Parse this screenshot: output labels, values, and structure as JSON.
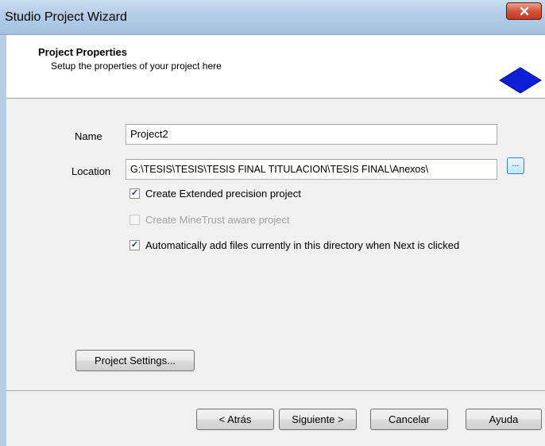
{
  "window": {
    "title": "Studio Project Wizard",
    "close_label": "x"
  },
  "header": {
    "title": "Project Properties",
    "subtitle": "Setup the properties of your project here",
    "icon": "blue-diamond-icon"
  },
  "form": {
    "name_label": "Name",
    "name_value": "Project2",
    "location_label": "Location",
    "location_value": "G:\\TESIS\\TESIS\\TESIS FINAL TITULACION\\TESIS FINAL\\Anexos\\",
    "browse_label": "...",
    "options": [
      {
        "label": "Create Extended precision project",
        "checked": true,
        "enabled": true
      },
      {
        "label": "Create MineTrust aware project",
        "checked": false,
        "enabled": false
      },
      {
        "label": "Automatically add files currently in this directory when Next is clicked",
        "checked": true,
        "enabled": true
      }
    ],
    "settings_button": "Project Settings..."
  },
  "footer": {
    "back": "< Atrás",
    "next": "Siguiente >",
    "cancel": "Cancelar",
    "help": "Ayuda"
  },
  "colors": {
    "accent": "#0a1fd6",
    "titlebar": "#b3cce6",
    "close": "#c13a20"
  }
}
